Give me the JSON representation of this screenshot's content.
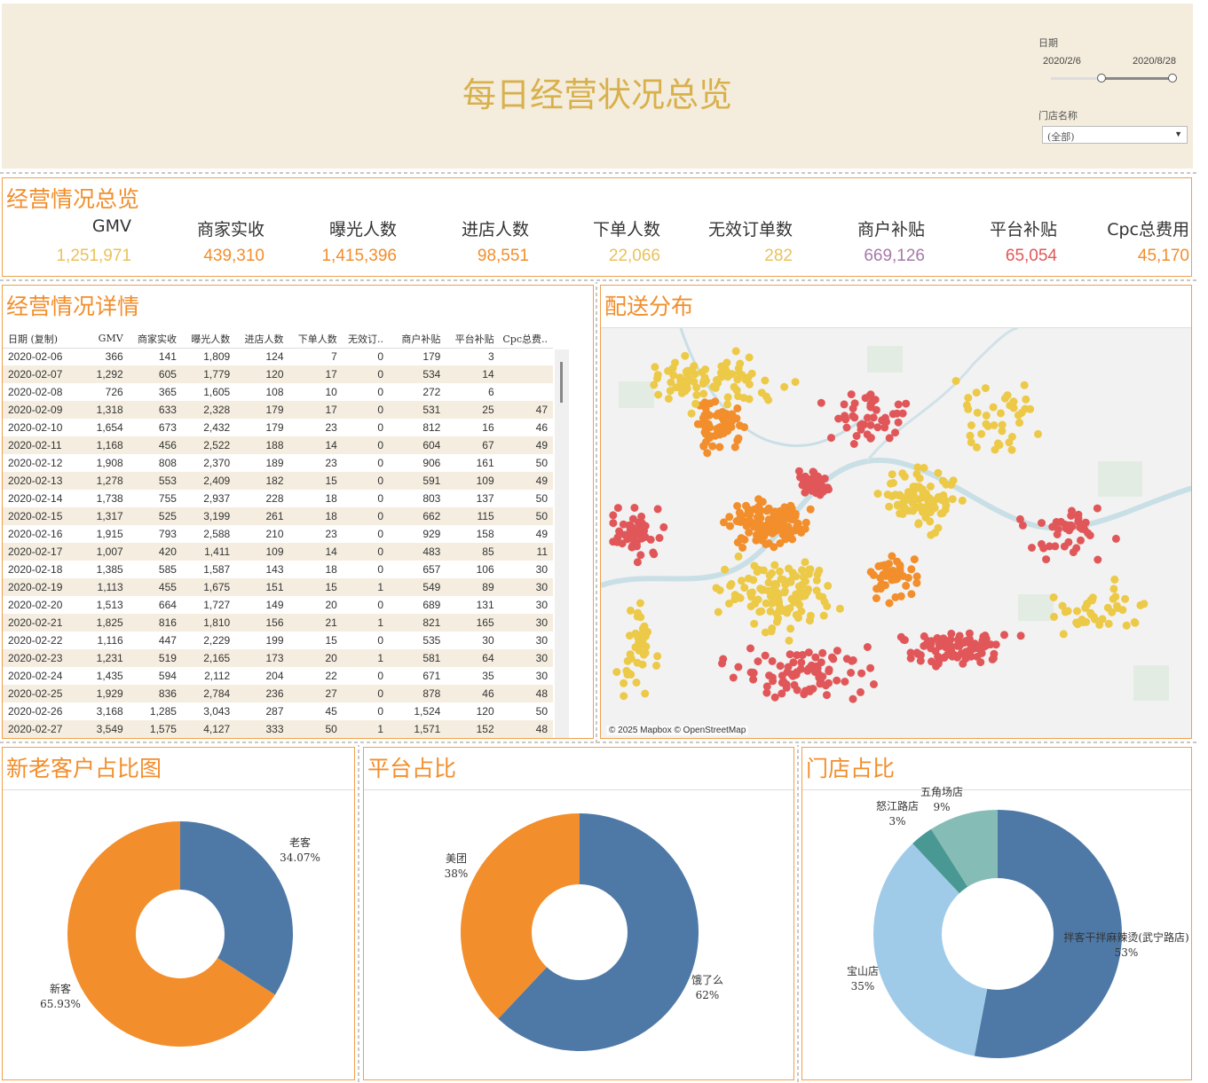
{
  "header": {
    "title": "每日经营状况总览",
    "date_filter_label": "日期",
    "date_start": "2020/2/6",
    "date_end": "2020/8/28",
    "store_filter_label": "门店名称",
    "store_filter_value": "(全部)"
  },
  "kpi": {
    "title": "经营情况总览",
    "items": [
      {
        "label": "GMV",
        "value": "1,251,971",
        "color": "#e9c25c"
      },
      {
        "label": "商家实收",
        "value": "439,310",
        "color": "#f28e2b"
      },
      {
        "label": "曝光人数",
        "value": "1,415,396",
        "color": "#f28e2b"
      },
      {
        "label": "进店人数",
        "value": "98,551",
        "color": "#f28e2b"
      },
      {
        "label": "下单人数",
        "value": "22,066",
        "color": "#e9c25c"
      },
      {
        "label": "无效订单数",
        "value": "282",
        "color": "#e9c25c"
      },
      {
        "label": "商户补贴",
        "value": "669,126",
        "color": "#a57ba6"
      },
      {
        "label": "平台补贴",
        "value": "65,054",
        "color": "#e15759"
      },
      {
        "label": "Cpc总费用",
        "value": "45,170",
        "color": "#f28e2b"
      }
    ]
  },
  "detail": {
    "title": "经营情况详情",
    "columns": [
      "日期 (复制)",
      "GMV",
      "商家实收",
      "曝光人数",
      "进店人数",
      "下单人数",
      "无效订..",
      "商户补贴",
      "平台补贴",
      "Cpc总费.."
    ],
    "rows": [
      [
        "2020-02-06",
        "366",
        "141",
        "1,809",
        "124",
        "7",
        "0",
        "179",
        "3",
        ""
      ],
      [
        "2020-02-07",
        "1,292",
        "605",
        "1,779",
        "120",
        "17",
        "0",
        "534",
        "14",
        ""
      ],
      [
        "2020-02-08",
        "726",
        "365",
        "1,605",
        "108",
        "10",
        "0",
        "272",
        "6",
        ""
      ],
      [
        "2020-02-09",
        "1,318",
        "633",
        "2,328",
        "179",
        "17",
        "0",
        "531",
        "25",
        "47"
      ],
      [
        "2020-02-10",
        "1,654",
        "673",
        "2,432",
        "179",
        "23",
        "0",
        "812",
        "16",
        "46"
      ],
      [
        "2020-02-11",
        "1,168",
        "456",
        "2,522",
        "188",
        "14",
        "0",
        "604",
        "67",
        "49"
      ],
      [
        "2020-02-12",
        "1,908",
        "808",
        "2,370",
        "189",
        "23",
        "0",
        "906",
        "161",
        "50"
      ],
      [
        "2020-02-13",
        "1,278",
        "553",
        "2,409",
        "182",
        "15",
        "0",
        "591",
        "109",
        "49"
      ],
      [
        "2020-02-14",
        "1,738",
        "755",
        "2,937",
        "228",
        "18",
        "0",
        "803",
        "137",
        "50"
      ],
      [
        "2020-02-15",
        "1,317",
        "525",
        "3,199",
        "261",
        "18",
        "0",
        "662",
        "115",
        "50"
      ],
      [
        "2020-02-16",
        "1,915",
        "793",
        "2,588",
        "210",
        "23",
        "0",
        "929",
        "158",
        "49"
      ],
      [
        "2020-02-17",
        "1,007",
        "420",
        "1,411",
        "109",
        "14",
        "0",
        "483",
        "85",
        "11"
      ],
      [
        "2020-02-18",
        "1,385",
        "585",
        "1,587",
        "143",
        "18",
        "0",
        "657",
        "106",
        "30"
      ],
      [
        "2020-02-19",
        "1,113",
        "455",
        "1,675",
        "151",
        "15",
        "1",
        "549",
        "89",
        "30"
      ],
      [
        "2020-02-20",
        "1,513",
        "664",
        "1,727",
        "149",
        "20",
        "0",
        "689",
        "131",
        "30"
      ],
      [
        "2020-02-21",
        "1,825",
        "816",
        "1,810",
        "156",
        "21",
        "1",
        "821",
        "165",
        "30"
      ],
      [
        "2020-02-22",
        "1,116",
        "447",
        "2,229",
        "199",
        "15",
        "0",
        "535",
        "30",
        "30"
      ],
      [
        "2020-02-23",
        "1,231",
        "519",
        "2,165",
        "173",
        "20",
        "1",
        "581",
        "64",
        "30"
      ],
      [
        "2020-02-24",
        "1,435",
        "594",
        "2,112",
        "204",
        "22",
        "0",
        "671",
        "35",
        "30"
      ],
      [
        "2020-02-25",
        "1,929",
        "836",
        "2,784",
        "236",
        "27",
        "0",
        "878",
        "46",
        "48"
      ],
      [
        "2020-02-26",
        "3,168",
        "1,285",
        "3,043",
        "287",
        "45",
        "0",
        "1,524",
        "120",
        "50"
      ],
      [
        "2020-02-27",
        "3,549",
        "1,575",
        "4,127",
        "333",
        "50",
        "1",
        "1,571",
        "152",
        "48"
      ]
    ]
  },
  "map": {
    "title": "配送分布",
    "attribution": "© 2025 Mapbox © OpenStreetMap"
  },
  "chart_data": [
    {
      "type": "pie",
      "title": "新老客户占比图",
      "labels": [
        "老客",
        "新客"
      ],
      "values": [
        34.07,
        65.93
      ],
      "display": [
        "34.07%",
        "65.93%"
      ],
      "colors": [
        "#4e79a7",
        "#f28e2b"
      ]
    },
    {
      "type": "pie",
      "title": "平台占比",
      "labels": [
        "饿了么",
        "美团"
      ],
      "values": [
        62,
        38
      ],
      "display": [
        "62%",
        "38%"
      ],
      "colors": [
        "#4e79a7",
        "#f28e2b"
      ]
    },
    {
      "type": "pie",
      "title": "门店占比",
      "labels": [
        "拌客干拌麻辣烫(武宁路店)",
        "宝山店",
        "怒江路店",
        "五角场店"
      ],
      "values": [
        53,
        35,
        3,
        9
      ],
      "display": [
        "53%",
        "35%",
        "3%",
        "9%"
      ],
      "colors": [
        "#4e79a7",
        "#a0cbe8",
        "#499894",
        "#86bcb6"
      ]
    }
  ]
}
